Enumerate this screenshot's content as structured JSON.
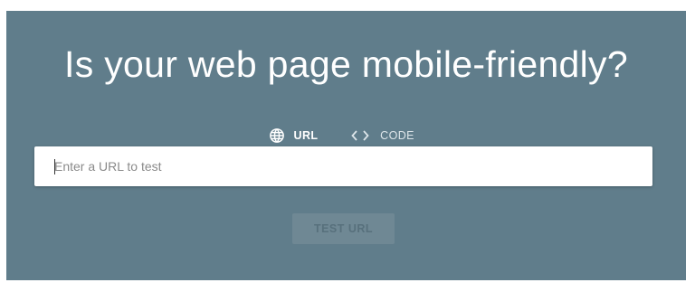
{
  "hero": {
    "title": "Is your web page mobile-friendly?"
  },
  "tabs": [
    {
      "label": "URL",
      "icon": "globe-icon",
      "selected": true
    },
    {
      "label": "CODE",
      "icon": "code-icon",
      "selected": false
    }
  ],
  "url_input": {
    "value": "",
    "placeholder": "Enter a URL to test"
  },
  "test_button": {
    "label": "TEST URL",
    "disabled": true
  },
  "colors": {
    "panel_background": "#607d8b",
    "tab_indicator": "#f9a825",
    "button_background": "#6f8894"
  }
}
